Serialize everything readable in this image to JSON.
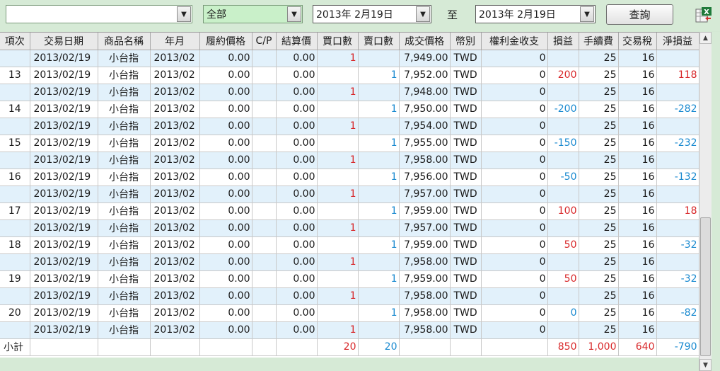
{
  "toolbar": {
    "account_value": "",
    "category_value": "全部",
    "date_from": "2013年  2月19日",
    "date_sep": "至",
    "date_to": "2013年  2月19日",
    "query_label": "查詢",
    "export_icon": "excel-export-icon"
  },
  "grid": {
    "columns": [
      "項次",
      "交易日期",
      "商品名稱",
      "年月",
      "履約價格",
      "C/P",
      "結算價",
      "買口數",
      "賣口數",
      "成交價格",
      "幣別",
      "權利金收支",
      "損益",
      "手續費",
      "交易稅",
      "淨損益"
    ],
    "rows": [
      {
        "no": "",
        "date": "2013/02/19",
        "product": "小台指",
        "ym": "2013/02",
        "strike": "0.00",
        "cp": "",
        "settle": "0.00",
        "buy": "1",
        "sell": "",
        "price": "7,949.00",
        "cur": "TWD",
        "premium": "0",
        "pl": "",
        "fee": "25",
        "tax": "16",
        "net": ""
      },
      {
        "no": "13",
        "date": "2013/02/19",
        "product": "小台指",
        "ym": "2013/02",
        "strike": "0.00",
        "cp": "",
        "settle": "0.00",
        "buy": "",
        "sell": "1",
        "price": "7,952.00",
        "cur": "TWD",
        "premium": "0",
        "pl": "200",
        "fee": "25",
        "tax": "16",
        "net": "118"
      },
      {
        "no": "",
        "date": "2013/02/19",
        "product": "小台指",
        "ym": "2013/02",
        "strike": "0.00",
        "cp": "",
        "settle": "0.00",
        "buy": "1",
        "sell": "",
        "price": "7,948.00",
        "cur": "TWD",
        "premium": "0",
        "pl": "",
        "fee": "25",
        "tax": "16",
        "net": ""
      },
      {
        "no": "14",
        "date": "2013/02/19",
        "product": "小台指",
        "ym": "2013/02",
        "strike": "0.00",
        "cp": "",
        "settle": "0.00",
        "buy": "",
        "sell": "1",
        "price": "7,950.00",
        "cur": "TWD",
        "premium": "0",
        "pl": "-200",
        "fee": "25",
        "tax": "16",
        "net": "-282"
      },
      {
        "no": "",
        "date": "2013/02/19",
        "product": "小台指",
        "ym": "2013/02",
        "strike": "0.00",
        "cp": "",
        "settle": "0.00",
        "buy": "1",
        "sell": "",
        "price": "7,954.00",
        "cur": "TWD",
        "premium": "0",
        "pl": "",
        "fee": "25",
        "tax": "16",
        "net": ""
      },
      {
        "no": "15",
        "date": "2013/02/19",
        "product": "小台指",
        "ym": "2013/02",
        "strike": "0.00",
        "cp": "",
        "settle": "0.00",
        "buy": "",
        "sell": "1",
        "price": "7,955.00",
        "cur": "TWD",
        "premium": "0",
        "pl": "-150",
        "fee": "25",
        "tax": "16",
        "net": "-232"
      },
      {
        "no": "",
        "date": "2013/02/19",
        "product": "小台指",
        "ym": "2013/02",
        "strike": "0.00",
        "cp": "",
        "settle": "0.00",
        "buy": "1",
        "sell": "",
        "price": "7,958.00",
        "cur": "TWD",
        "premium": "0",
        "pl": "",
        "fee": "25",
        "tax": "16",
        "net": ""
      },
      {
        "no": "16",
        "date": "2013/02/19",
        "product": "小台指",
        "ym": "2013/02",
        "strike": "0.00",
        "cp": "",
        "settle": "0.00",
        "buy": "",
        "sell": "1",
        "price": "7,956.00",
        "cur": "TWD",
        "premium": "0",
        "pl": "-50",
        "fee": "25",
        "tax": "16",
        "net": "-132"
      },
      {
        "no": "",
        "date": "2013/02/19",
        "product": "小台指",
        "ym": "2013/02",
        "strike": "0.00",
        "cp": "",
        "settle": "0.00",
        "buy": "1",
        "sell": "",
        "price": "7,957.00",
        "cur": "TWD",
        "premium": "0",
        "pl": "",
        "fee": "25",
        "tax": "16",
        "net": ""
      },
      {
        "no": "17",
        "date": "2013/02/19",
        "product": "小台指",
        "ym": "2013/02",
        "strike": "0.00",
        "cp": "",
        "settle": "0.00",
        "buy": "",
        "sell": "1",
        "price": "7,959.00",
        "cur": "TWD",
        "premium": "0",
        "pl": "100",
        "fee": "25",
        "tax": "16",
        "net": "18"
      },
      {
        "no": "",
        "date": "2013/02/19",
        "product": "小台指",
        "ym": "2013/02",
        "strike": "0.00",
        "cp": "",
        "settle": "0.00",
        "buy": "1",
        "sell": "",
        "price": "7,957.00",
        "cur": "TWD",
        "premium": "0",
        "pl": "",
        "fee": "25",
        "tax": "16",
        "net": ""
      },
      {
        "no": "18",
        "date": "2013/02/19",
        "product": "小台指",
        "ym": "2013/02",
        "strike": "0.00",
        "cp": "",
        "settle": "0.00",
        "buy": "",
        "sell": "1",
        "price": "7,959.00",
        "cur": "TWD",
        "premium": "0",
        "pl": "50",
        "fee": "25",
        "tax": "16",
        "net": "-32"
      },
      {
        "no": "",
        "date": "2013/02/19",
        "product": "小台指",
        "ym": "2013/02",
        "strike": "0.00",
        "cp": "",
        "settle": "0.00",
        "buy": "1",
        "sell": "",
        "price": "7,958.00",
        "cur": "TWD",
        "premium": "0",
        "pl": "",
        "fee": "25",
        "tax": "16",
        "net": ""
      },
      {
        "no": "19",
        "date": "2013/02/19",
        "product": "小台指",
        "ym": "2013/02",
        "strike": "0.00",
        "cp": "",
        "settle": "0.00",
        "buy": "",
        "sell": "1",
        "price": "7,959.00",
        "cur": "TWD",
        "premium": "0",
        "pl": "50",
        "fee": "25",
        "tax": "16",
        "net": "-32"
      },
      {
        "no": "",
        "date": "2013/02/19",
        "product": "小台指",
        "ym": "2013/02",
        "strike": "0.00",
        "cp": "",
        "settle": "0.00",
        "buy": "1",
        "sell": "",
        "price": "7,958.00",
        "cur": "TWD",
        "premium": "0",
        "pl": "",
        "fee": "25",
        "tax": "16",
        "net": ""
      },
      {
        "no": "20",
        "date": "2013/02/19",
        "product": "小台指",
        "ym": "2013/02",
        "strike": "0.00",
        "cp": "",
        "settle": "0.00",
        "buy": "",
        "sell": "1",
        "price": "7,958.00",
        "cur": "TWD",
        "premium": "0",
        "pl": "0",
        "fee": "25",
        "tax": "16",
        "net": "-82"
      },
      {
        "no": "",
        "date": "2013/02/19",
        "product": "小台指",
        "ym": "2013/02",
        "strike": "0.00",
        "cp": "",
        "settle": "0.00",
        "buy": "1",
        "sell": "",
        "price": "7,958.00",
        "cur": "TWD",
        "premium": "0",
        "pl": "",
        "fee": "25",
        "tax": "16",
        "net": ""
      }
    ],
    "summary": {
      "label": "小計",
      "buy": "20",
      "sell": "20",
      "pl": "850",
      "fee": "1,000",
      "tax": "640",
      "net": "-790"
    }
  },
  "colors": {
    "alt_row": "#e2f1fb",
    "buy": "#d8282a",
    "sell": "#1a8ad0",
    "panel": "#d6ead6"
  }
}
